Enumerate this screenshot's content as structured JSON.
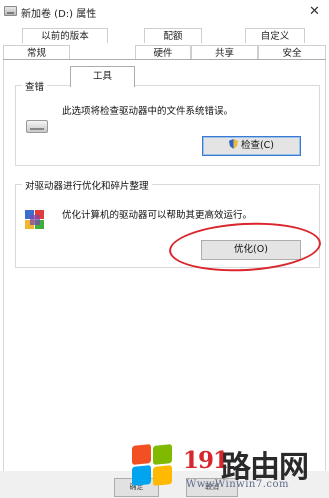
{
  "window": {
    "title": "新加卷 (D:) 属性",
    "close_glyph": "✕",
    "icon": "drive-icon"
  },
  "tabs": {
    "row_top": [
      "以前的版本",
      "配额",
      "自定义"
    ],
    "row_bottom": [
      "常规",
      "工具",
      "硬件",
      "共享",
      "安全"
    ],
    "active": "工具"
  },
  "error_check": {
    "title": "查错",
    "description": "此选项将检查驱动器中的文件系统错误。",
    "button_label": "检查(C)",
    "icon": "drive-icon",
    "button_icon": "shield-icon"
  },
  "optimize": {
    "title": "对驱动器进行优化和碎片整理",
    "description": "优化计算机的驱动器可以帮助其更高效运行。",
    "button_label": "优化(O)",
    "icon": "defrag-icon",
    "highlight_color": "#d9252b"
  },
  "dialog_buttons": {
    "ok": "确定",
    "cancel": "取消"
  },
  "watermark": {
    "number": "191",
    "text": "路由网",
    "url": "WwwWinwin7.com",
    "logo": "windows-logo-icon"
  }
}
